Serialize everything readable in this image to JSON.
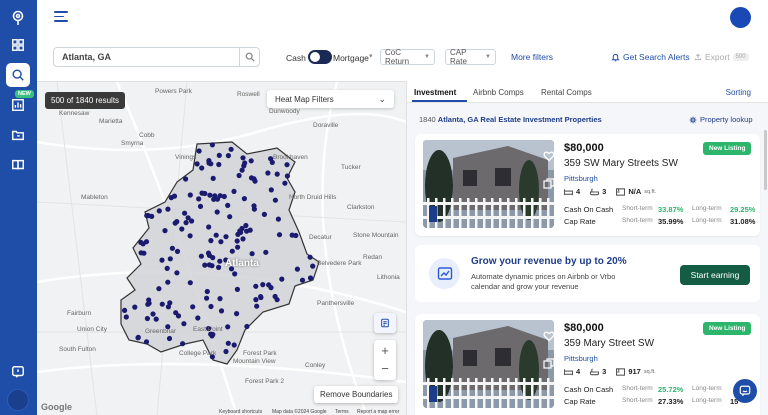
{
  "app": {
    "brand_icon": "pin-logo-icon"
  },
  "sidebar": {
    "items": [
      {
        "icon": "grid-icon"
      },
      {
        "icon": "search-icon",
        "active": true
      },
      {
        "icon": "chart-icon",
        "badge": "NEW"
      },
      {
        "icon": "folder-icon"
      },
      {
        "icon": "book-icon"
      },
      {
        "icon": "help-icon"
      }
    ]
  },
  "search": {
    "value": "Atlanta, GA",
    "placeholder": "Search location"
  },
  "filters": {
    "cash_label": "Cash",
    "mortgage_label": "Mortgage",
    "coc_label": "CoC Return",
    "cap_label": "CAP Rate",
    "more_label": "More filters",
    "alerts_label": "Get Search Alerts",
    "export_label": "Export",
    "export_count": "500"
  },
  "map": {
    "results_pill": "500 of 1840 results",
    "heatmap_label": "Heat Map Filters",
    "remove_label": "Remove Boundaries",
    "google_label": "Google",
    "attribution": [
      "Keyboard shortcuts",
      "Map data ©2024 Google",
      "Terms",
      "Report a map error"
    ],
    "places": [
      "Powers Park",
      "Marietta",
      "Roswell",
      "Dunwoody",
      "Kennesaw",
      "Cobb",
      "Doraville",
      "Smyrna",
      "Vinings",
      "Brookhaven",
      "Tucker",
      "Mableton",
      "North Druid Hills",
      "Clarkston",
      "Decatur",
      "Stone Mountain",
      "Redan",
      "Belvedere Park",
      "Lithonia",
      "Atlanta",
      "Panthersville",
      "Fairburn",
      "Union City",
      "Greenbriar",
      "East Point",
      "South Fulton",
      "Forest Park",
      "College Park",
      "Mountain View",
      "Conley",
      "Forest Park 2"
    ]
  },
  "panel": {
    "tabs": [
      "Investment",
      "Airbnb Comps",
      "Rental Comps"
    ],
    "sorting_label": "Sorting",
    "results_count": "1840",
    "results_title": "Atlanta, GA Real Estate Investment Properties",
    "lookup_label": "Property lookup"
  },
  "listings": [
    {
      "price": "$80,000",
      "address": "359 SW Mary Streets SW",
      "city": "Pittsburgh",
      "badge": "New Listing",
      "beds": "4",
      "baths": "3",
      "sqft": "N/A",
      "sqft_unit": "sq.ft.",
      "coc_label": "Cash On Cash",
      "cap_label": "Cap Rate",
      "short_label": "Short-term",
      "long_label": "Long-term",
      "coc_short": "33.87%",
      "coc_long": "29.25%",
      "cap_short": "35.99%",
      "cap_long": "31.08%"
    },
    {
      "price": "$80,000",
      "address": "359 Mary Street SW",
      "city": "Pittsburgh",
      "badge": "New Listing",
      "beds": "4",
      "baths": "3",
      "sqft": "917",
      "sqft_unit": "sq.ft.",
      "coc_label": "Cash On Cash",
      "cap_label": "Cap Rate",
      "short_label": "Short-term",
      "long_label": "Long-term",
      "coc_short": "25.72%",
      "coc_long": "",
      "cap_short": "27.33%",
      "cap_long": "15"
    }
  ],
  "promo": {
    "title": "Grow your revenue by up to 20%",
    "description": "Automate dynamic prices on Airbnb or Vrbo calendar and grow your revenue",
    "button": "Start earning"
  },
  "colors": {
    "brand": "#1f4ea8",
    "green": "#2cb56b",
    "dark_green": "#145c44",
    "marker": "#1a1a6e"
  }
}
